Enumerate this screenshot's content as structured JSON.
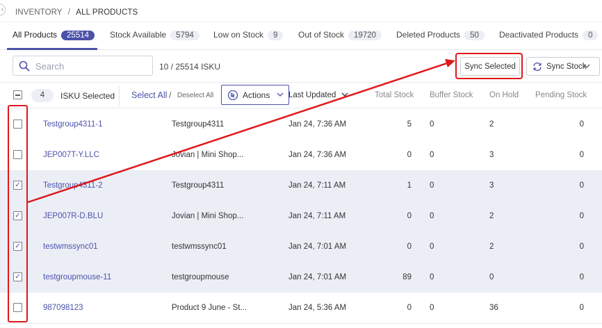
{
  "breadcrumb": {
    "parent": "INVENTORY",
    "separator": "/",
    "current": "ALL PRODUCTS"
  },
  "tabs": [
    {
      "label": "All Products",
      "count": "25514",
      "active": true
    },
    {
      "label": "Stock Available",
      "count": "5794"
    },
    {
      "label": "Low on Stock",
      "count": "9"
    },
    {
      "label": "Out of Stock",
      "count": "19720"
    },
    {
      "label": "Deleted Products",
      "count": "50"
    },
    {
      "label": "Deactivated Products",
      "count": "0"
    }
  ],
  "toolbar": {
    "search_placeholder": "Search",
    "isku_count_selected": "10",
    "isku_count_text": " / 25514 ISKU",
    "sync_selected_label": "Sync Selected",
    "sync_stock_label": "Sync Stock"
  },
  "table_header": {
    "selected_count": "4",
    "selected_label": "ISKU Selected",
    "select_all": "Select All",
    "slash": "/",
    "deselect_all": "Deselect All",
    "actions_label": "Actions",
    "columns": {
      "last_updated": "Last Updated",
      "total_stock": "Total Stock",
      "buffer_stock": "Buffer Stock",
      "on_hold": "On Hold",
      "pending_stock": "Pending Stock"
    }
  },
  "rows": [
    {
      "isku": "Testgroup4311-1",
      "name": "Testgroup4311",
      "updated": "Jan 24, 7:36 AM",
      "total": "5",
      "buffer": "0",
      "on_hold": "2",
      "pending": "0",
      "checked": false
    },
    {
      "isku": "JEP007T-Y.LLC",
      "name": "Jovian | Mini Shop...",
      "updated": "Jan 24, 7:36 AM",
      "total": "0",
      "buffer": "0",
      "on_hold": "3",
      "pending": "0",
      "checked": false
    },
    {
      "isku": "Testgroup4311-2",
      "name": "Testgroup4311",
      "updated": "Jan 24, 7:11 AM",
      "total": "1",
      "buffer": "0",
      "on_hold": "3",
      "pending": "0",
      "checked": true
    },
    {
      "isku": "JEP007R-D.BLU",
      "name": "Jovian | Mini Shop...",
      "updated": "Jan 24, 7:11 AM",
      "total": "0",
      "buffer": "0",
      "on_hold": "2",
      "pending": "0",
      "checked": true
    },
    {
      "isku": "testwmssync01",
      "name": "testwmssync01",
      "updated": "Jan 24, 7:01 AM",
      "total": "0",
      "buffer": "0",
      "on_hold": "2",
      "pending": "0",
      "checked": true
    },
    {
      "isku": "testgroupmouse-11",
      "name": "testgroupmouse",
      "updated": "Jan 24, 7:01 AM",
      "total": "89",
      "buffer": "0",
      "on_hold": "0",
      "pending": "0",
      "checked": true
    },
    {
      "isku": "987098123",
      "name": "Product 9 June - St...",
      "updated": "Jan 24, 5:36 AM",
      "total": "0",
      "buffer": "0",
      "on_hold": "36",
      "pending": "0",
      "checked": false
    }
  ],
  "colors": {
    "accent": "#4b52a8",
    "annotation": "#e0161b",
    "selected_row": "#eceef6"
  },
  "icons": {
    "search": "search-icon",
    "sync": "sync-icon",
    "actions": "cursor-click-icon",
    "chevron": "chevron-down-icon"
  }
}
